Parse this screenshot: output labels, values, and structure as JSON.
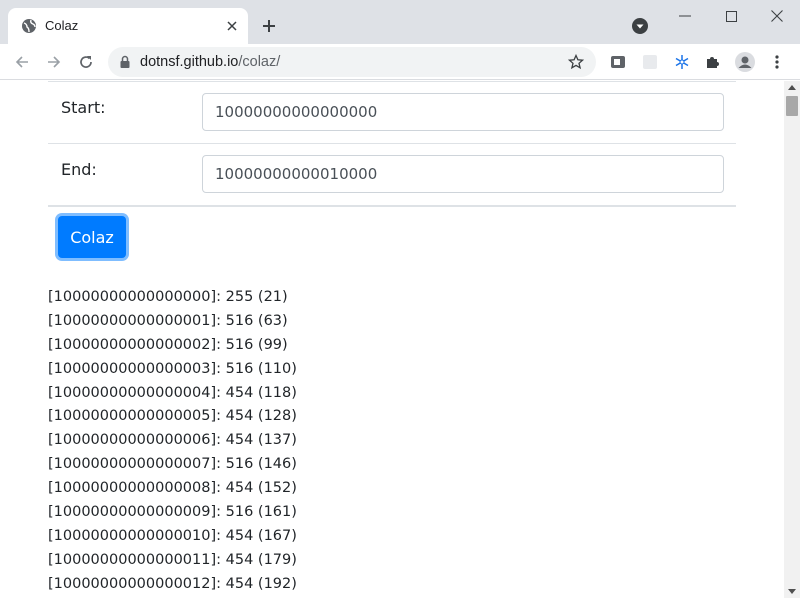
{
  "browser": {
    "tab_title": "Colaz",
    "url_host": "dotnsf.github.io",
    "url_path": "/colaz/"
  },
  "form": {
    "start_label": "Start:",
    "start_value": "10000000000000000",
    "end_label": "End:",
    "end_value": "10000000000010000",
    "submit_label": "Colaz"
  },
  "results": [
    "[10000000000000000]: 255 (21)",
    "[10000000000000001]: 516 (63)",
    "[10000000000000002]: 516 (99)",
    "[10000000000000003]: 516 (110)",
    "[10000000000000004]: 454 (118)",
    "[10000000000000005]: 454 (128)",
    "[10000000000000006]: 454 (137)",
    "[10000000000000007]: 516 (146)",
    "[10000000000000008]: 454 (152)",
    "[10000000000000009]: 516 (161)",
    "[10000000000000010]: 454 (167)",
    "[10000000000000011]: 454 (179)",
    "[10000000000000012]: 454 (192)"
  ],
  "colors": {
    "primary": "#007bff",
    "tabstrip": "#dee1e6",
    "text": "#212529"
  }
}
